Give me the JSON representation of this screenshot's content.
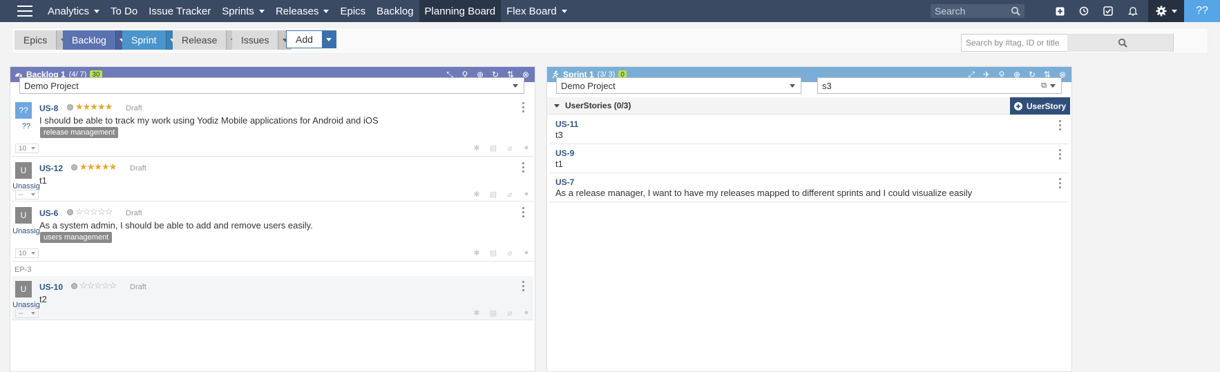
{
  "nav": {
    "items": [
      {
        "label": "Analytics",
        "caret": true
      },
      {
        "label": "To Do",
        "caret": false
      },
      {
        "label": "Issue Tracker",
        "caret": false
      },
      {
        "label": "Sprints",
        "caret": true
      },
      {
        "label": "Releases",
        "caret": true
      },
      {
        "label": "Epics",
        "caret": false
      },
      {
        "label": "Backlog",
        "caret": false
      },
      {
        "label": "Planning Board",
        "caret": false,
        "active": true
      },
      {
        "label": "Flex Board",
        "caret": true
      }
    ],
    "search_placeholder": "Search",
    "avatar": "??"
  },
  "toolbar": {
    "epics": "Epics",
    "backlog": "Backlog",
    "sprint": "Sprint",
    "release": "Release",
    "issues": "Issues",
    "add": "Add",
    "search_placeholder": "Search by #tag, ID or title"
  },
  "backlog": {
    "title": "Backlog 1",
    "count": "(4/ 7)",
    "badge": "30",
    "project": "Demo Project",
    "cards": [
      {
        "id": "US-8",
        "avatar": "??",
        "avatar_name": "??",
        "stars_filled": true,
        "status": "Draft",
        "desc": "I should be able to track my work using Yodiz Mobile applications for Android and iOS",
        "tag": "release management",
        "estimate": "10"
      },
      {
        "id": "US-12",
        "avatar": "U",
        "avatar_name": "Unassig",
        "stars_filled": true,
        "status": "Draft",
        "desc": "t1",
        "tag": "",
        "estimate": "--"
      },
      {
        "id": "US-6",
        "avatar": "U",
        "avatar_name": "Unassig",
        "stars_filled": false,
        "status": "Draft",
        "desc": "As a system admin, I should be able to add and remove users easily.",
        "tag": "users management",
        "estimate": "10"
      },
      {
        "id": "US-10",
        "avatar": "U",
        "avatar_name": "Unassig",
        "stars_filled": false,
        "status": "Draft",
        "desc": "t2",
        "tag": "",
        "estimate": "--"
      }
    ],
    "epic_label": "EP-3"
  },
  "sprint": {
    "title": "Sprint 1",
    "count": "(3/ 3)",
    "badge": "0",
    "project": "Demo Project",
    "filter": "s3",
    "group_label": "UserStories (0/3)",
    "add_button": "UserStory",
    "rows": [
      {
        "id": "US-11",
        "desc": "t3"
      },
      {
        "id": "US-9",
        "desc": "t1"
      },
      {
        "id": "US-7",
        "desc": "As a release manager, I want to have my releases mapped to different sprints and I could visualize easily"
      }
    ]
  },
  "colors": {
    "nav_bg": "#3b4a63",
    "backlog_header": "#6f7ab8",
    "sprint_header": "#7aaed6",
    "link": "#2f5589"
  }
}
